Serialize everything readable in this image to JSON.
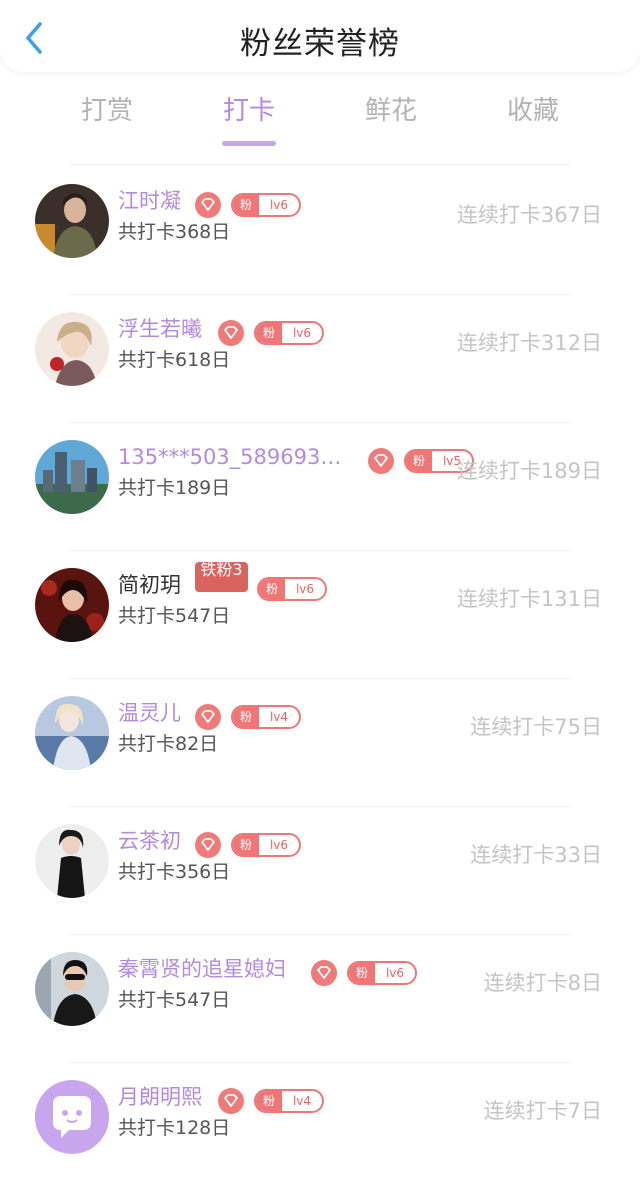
{
  "header": {
    "title": "粉丝荣誉榜"
  },
  "tabs": [
    {
      "label": "打赏",
      "active": false
    },
    {
      "label": "打卡",
      "active": true
    },
    {
      "label": "鲜花",
      "active": false
    },
    {
      "label": "收藏",
      "active": false
    }
  ],
  "badge_prefix": "粉",
  "rows": [
    {
      "name": "江时凝",
      "level": "lv6",
      "total": "共打卡368日",
      "streak": "连续打卡367日"
    },
    {
      "name": "浮生若曦",
      "level": "lv6",
      "total": "共打卡618日",
      "streak": "连续打卡312日"
    },
    {
      "name": "135***503_589693…",
      "level": "lv5",
      "total": "共打卡189日",
      "streak": "连续打卡189日"
    },
    {
      "name": "简初玥",
      "level": "lv6",
      "total": "共打卡547日",
      "streak": "连续打卡131日",
      "extra_badge": "铁粉3"
    },
    {
      "name": "温灵儿",
      "level": "lv4",
      "total": "共打卡82日",
      "streak": "连续打卡75日"
    },
    {
      "name": "云茶初",
      "level": "lv6",
      "total": "共打卡356日",
      "streak": "连续打卡33日"
    },
    {
      "name": "秦霄贤的追星媳妇",
      "level": "lv6",
      "total": "共打卡547日",
      "streak": "连续打卡8日"
    },
    {
      "name": "月朗明熙",
      "level": "lv4",
      "total": "共打卡128日",
      "streak": "连续打卡7日"
    }
  ],
  "colors": {
    "accent": "#b48ae0",
    "badge": "#ee7676",
    "streak_text": "#c4c4c4"
  }
}
